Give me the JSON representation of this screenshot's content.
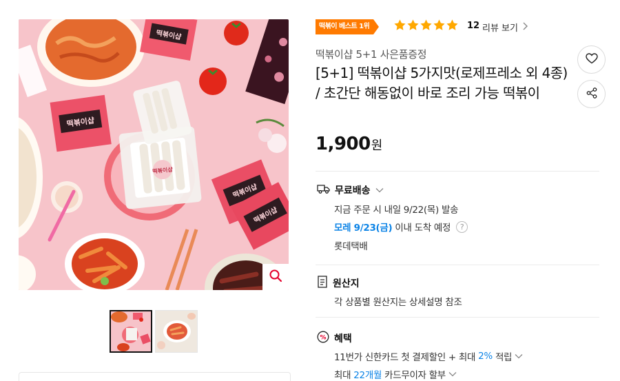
{
  "badge": {
    "label": "떡볶이 베스트 1위"
  },
  "rating": {
    "stars": 5,
    "review_count": "12",
    "review_link": "리뷰 보기"
  },
  "seller": "떡볶이샵 5+1 사은품증정",
  "product": {
    "title": "[5+1] 떡볶이샵 5가지맛(로제프레소 외 4종) / 초간단 해동없이 바로 조리 가능 떡볶이",
    "price": "1,900",
    "price_unit": "원"
  },
  "image_labels": {
    "pack_main": "떡볶이샵",
    "pack_small": "떡볶이샵"
  },
  "delivery": {
    "title": "무료배송",
    "line1": "지금 주문 시 내일 9/22(목) 발송",
    "arrival_date": "모레 9/23(금)",
    "arrival_suffix": "이내 도착 예정",
    "help": "?",
    "courier": "롯데택배"
  },
  "origin": {
    "title": "원산지",
    "text": "각 상품별 원산지는 상세설명 참조"
  },
  "benefits": {
    "title": "혜택",
    "line1_prefix": "11번가 신한카드 첫 결제할인 + 최대",
    "line1_pct": "2%",
    "line1_suffix": "적립",
    "line2_prefix": "최대",
    "line2_months": "22개월",
    "line2_suffix": "카드무이자 할부"
  },
  "colors": {
    "accent_orange": "#ff7a00",
    "star": "#ffa800",
    "link_blue": "#0b83e6"
  },
  "icons": [
    "magnifier-icon",
    "heart-icon",
    "share-icon",
    "truck-icon",
    "document-icon",
    "percent-icon",
    "chevron-right-icon",
    "chevron-down-icon",
    "question-icon"
  ]
}
